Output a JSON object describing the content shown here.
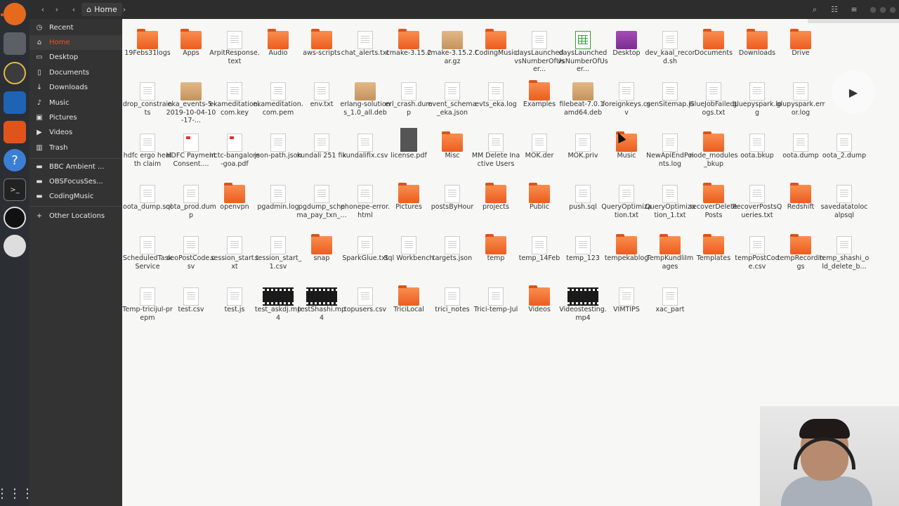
{
  "window": {
    "path_button": "Home"
  },
  "sidebar": {
    "items": [
      {
        "label": "Recent",
        "icon": "clock-icon"
      },
      {
        "label": "Home",
        "icon": "home-icon"
      },
      {
        "label": "Desktop",
        "icon": "desktop-icon"
      },
      {
        "label": "Documents",
        "icon": "document-icon"
      },
      {
        "label": "Downloads",
        "icon": "download-icon"
      },
      {
        "label": "Music",
        "icon": "music-icon"
      },
      {
        "label": "Pictures",
        "icon": "pictures-icon"
      },
      {
        "label": "Videos",
        "icon": "video-icon"
      },
      {
        "label": "Trash",
        "icon": "trash-icon"
      },
      {
        "label": "BBC Ambient ...",
        "icon": "folder-icon"
      },
      {
        "label": "OBSFocusSes...",
        "icon": "folder-icon"
      },
      {
        "label": "CodingMusic",
        "icon": "folder-icon"
      },
      {
        "label": "Other Locations",
        "icon": "plus-icon"
      }
    ]
  },
  "files": [
    {
      "name": "19Febs31logs",
      "type": "folder"
    },
    {
      "name": "Apps",
      "type": "folder"
    },
    {
      "name": "ArpitResponse.text",
      "type": "doc"
    },
    {
      "name": "Audio",
      "type": "folder"
    },
    {
      "name": "aws-scripts",
      "type": "folder"
    },
    {
      "name": "chat_alerts.txt",
      "type": "doc"
    },
    {
      "name": "cmake-3.15.2",
      "type": "folder"
    },
    {
      "name": "cmake-3.15.2.tar.gz",
      "type": "pkg"
    },
    {
      "name": "CodingMusic",
      "type": "folder"
    },
    {
      "name": "daysLaunchedvsNumberOfUser...",
      "type": "doc"
    },
    {
      "name": "daysLaunchedvsNumberOfUser...",
      "type": "sheet"
    },
    {
      "name": "Desktop",
      "type": "desktop"
    },
    {
      "name": "dev_kaal_record.sh",
      "type": "doc"
    },
    {
      "name": "Documents",
      "type": "folder"
    },
    {
      "name": "Downloads",
      "type": "folder"
    },
    {
      "name": "Drive",
      "type": "folder"
    },
    {
      "name": "drop_constraints",
      "type": "doc"
    },
    {
      "name": "eka_events-5-2019-10-04-10-17-...",
      "type": "pkg"
    },
    {
      "name": "ekameditation.com.key",
      "type": "doc"
    },
    {
      "name": "ekameditation.com.pem",
      "type": "doc"
    },
    {
      "name": "env.txt",
      "type": "doc"
    },
    {
      "name": "erlang-solutions_1.0_all.deb",
      "type": "pkg"
    },
    {
      "name": "erl_crash.dump",
      "type": "doc"
    },
    {
      "name": "event_schema_eka.json",
      "type": "doc"
    },
    {
      "name": "evts_eka.log",
      "type": "doc"
    },
    {
      "name": "Examples",
      "type": "folder"
    },
    {
      "name": "filebeat-7.0.1-amd64.deb",
      "type": "pkg"
    },
    {
      "name": "foreignkeys.csv",
      "type": "doc"
    },
    {
      "name": "genSitemap.js",
      "type": "doc"
    },
    {
      "name": "GlueJobFailedLogs.txt",
      "type": "doc"
    },
    {
      "name": "gluepyspark.log",
      "type": "doc"
    },
    {
      "name": "glupyspark.error.log",
      "type": "doc"
    },
    {
      "name": "hdfc ergo health claim",
      "type": "doc"
    },
    {
      "name": "HDFC Payment Consent....",
      "type": "pdf"
    },
    {
      "name": "irctc-bangalore-goa.pdf",
      "type": "pdf"
    },
    {
      "name": "json-path.json",
      "type": "doc"
    },
    {
      "name": "kundali 251 fix",
      "type": "doc"
    },
    {
      "name": "kundalifix.csv",
      "type": "doc"
    },
    {
      "name": "license.pdf",
      "type": "img"
    },
    {
      "name": "Misc",
      "type": "folder"
    },
    {
      "name": "MM Delete Inactive Users",
      "type": "doc"
    },
    {
      "name": "MOK.der",
      "type": "doc"
    },
    {
      "name": "MOK.priv",
      "type": "doc"
    },
    {
      "name": "Music",
      "type": "folder"
    },
    {
      "name": "NewApiEndPoints.log",
      "type": "doc"
    },
    {
      "name": "node_modules_bkup",
      "type": "folder"
    },
    {
      "name": "oota.bkup",
      "type": "doc"
    },
    {
      "name": "oota.dump",
      "type": "doc"
    },
    {
      "name": "oota_2.dump",
      "type": "doc"
    },
    {
      "name": "oota_dump.sql",
      "type": "doc"
    },
    {
      "name": "oota_prod.dump",
      "type": "doc"
    },
    {
      "name": "openvpn",
      "type": "folder"
    },
    {
      "name": "pgadmin.log",
      "type": "doc"
    },
    {
      "name": "pgdump_schema_pay_txn_...",
      "type": "doc"
    },
    {
      "name": "phonepe-error.html",
      "type": "doc"
    },
    {
      "name": "Pictures",
      "type": "folder"
    },
    {
      "name": "postsByHour",
      "type": "doc"
    },
    {
      "name": "projects",
      "type": "folder"
    },
    {
      "name": "Public",
      "type": "folder"
    },
    {
      "name": "push.sql",
      "type": "doc"
    },
    {
      "name": "QueryOptimization.txt",
      "type": "doc"
    },
    {
      "name": "QueryOptimization_1.txt",
      "type": "doc"
    },
    {
      "name": "recoverDeletePosts",
      "type": "folder"
    },
    {
      "name": "RecoverPostsQueries.txt",
      "type": "doc"
    },
    {
      "name": "Redshift",
      "type": "folder"
    },
    {
      "name": "savedatatolocalpsql",
      "type": "doc"
    },
    {
      "name": "ScheduledTaskService",
      "type": "doc"
    },
    {
      "name": "seoPostCode.csv",
      "type": "doc"
    },
    {
      "name": "session_start.txt",
      "type": "doc"
    },
    {
      "name": "session_start_1.csv",
      "type": "doc"
    },
    {
      "name": "snap",
      "type": "folder"
    },
    {
      "name": "SparkGlue.txt",
      "type": "doc"
    },
    {
      "name": "Sql Workbench",
      "type": "blank"
    },
    {
      "name": "targets.json",
      "type": "doc"
    },
    {
      "name": "temp",
      "type": "folder"
    },
    {
      "name": "temp_14Feb",
      "type": "doc"
    },
    {
      "name": "temp_123",
      "type": "doc"
    },
    {
      "name": "tempekablog",
      "type": "folder"
    },
    {
      "name": "TempKundliImages",
      "type": "folder"
    },
    {
      "name": "Templates",
      "type": "folder"
    },
    {
      "name": "tempPostCode.csv",
      "type": "doc"
    },
    {
      "name": "tempRecordings",
      "type": "folder"
    },
    {
      "name": "temp_shashi_old_delete_b...",
      "type": "doc"
    },
    {
      "name": "Temp-tricijul-prepm",
      "type": "doc"
    },
    {
      "name": "test.csv",
      "type": "doc"
    },
    {
      "name": "test.js",
      "type": "doc"
    },
    {
      "name": "test_askdj.mp4",
      "type": "video"
    },
    {
      "name": "testShashi.mp4",
      "type": "video"
    },
    {
      "name": "topusers.csv",
      "type": "doc"
    },
    {
      "name": "TriciLocal",
      "type": "folder"
    },
    {
      "name": "trici_notes",
      "type": "doc"
    },
    {
      "name": "Trici-temp-Jul",
      "type": "doc"
    },
    {
      "name": "Videos",
      "type": "folder"
    },
    {
      "name": "Videostesting.mp4",
      "type": "video"
    },
    {
      "name": "VIMTIPS",
      "type": "doc"
    },
    {
      "name": "xac_part",
      "type": "doc"
    }
  ]
}
